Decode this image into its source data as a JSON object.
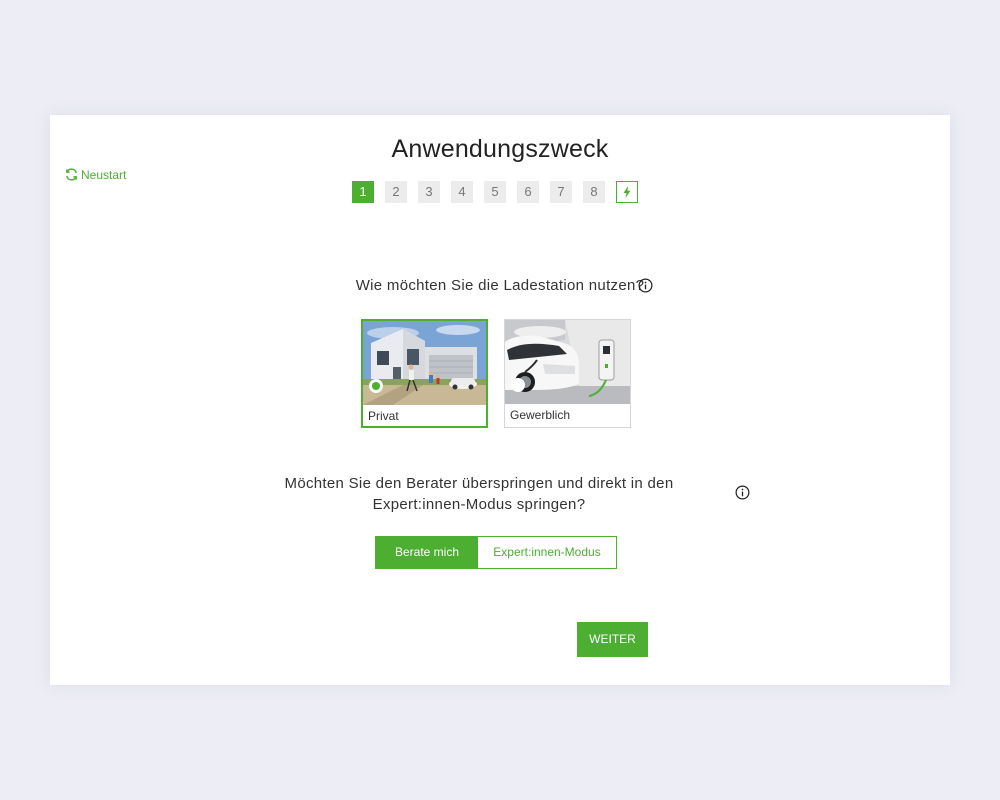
{
  "header": {
    "restart_label": "Neustart",
    "title": "Anwendungszweck"
  },
  "steps": [
    "1",
    "2",
    "3",
    "4",
    "5",
    "6",
    "7",
    "8"
  ],
  "steps_current": 1,
  "steps_final_icon": "bolt-icon",
  "question_usage": "Wie möchten Sie die Ladestation nutzen?",
  "usage_options": [
    {
      "label": "Privat",
      "selected": true,
      "image": "house-family-car-photo"
    },
    {
      "label": "Gewerblich",
      "selected": false,
      "image": "car-charging-at-wallbox-photo"
    }
  ],
  "question_mode": "Möchten Sie den Berater überspringen und direkt in den Expert:innen-Modus springen?",
  "mode_toggle": {
    "advise_label": "Berate mich",
    "expert_label": "Expert:innen-Modus",
    "selected": "advise"
  },
  "next_button": "WEITER",
  "colors": {
    "accent": "#4caf32",
    "background": "#ecedf5",
    "card": "#ffffff"
  }
}
